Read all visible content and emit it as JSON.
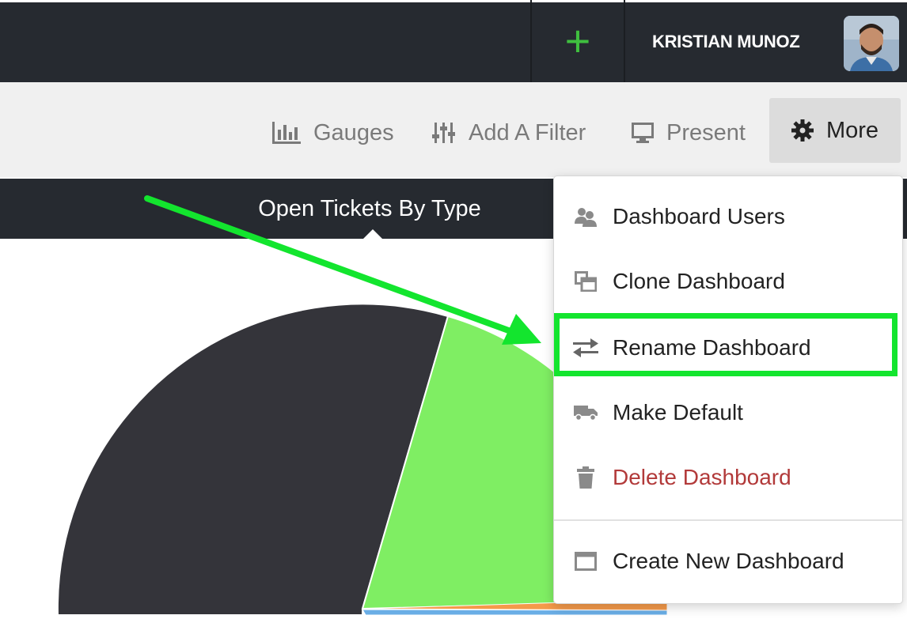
{
  "header": {
    "add_symbol": "+",
    "user_name": "KRISTIAN MUNOZ"
  },
  "toolbar": {
    "gauges_label": "Gauges",
    "add_filter_label": "Add A Filter",
    "present_label": "Present",
    "more_label": "More"
  },
  "chart": {
    "title": "Open Tickets By Type"
  },
  "chart_data": {
    "type": "pie",
    "title": "Open Tickets By Type",
    "slice_colors": [
      "#34343a",
      "#7fee63",
      "#f59a4a",
      "#6aaee6"
    ]
  },
  "more_menu": {
    "items": [
      {
        "label": "Dashboard Users",
        "icon": "users-icon"
      },
      {
        "label": "Clone Dashboard",
        "icon": "clone-icon"
      },
      {
        "label": "Rename Dashboard",
        "icon": "swap-arrows-icon"
      },
      {
        "label": "Make Default",
        "icon": "truck-icon"
      },
      {
        "label": "Delete Dashboard",
        "icon": "trash-icon"
      },
      {
        "label": "Create New Dashboard",
        "icon": "window-icon"
      }
    ]
  },
  "colors": {
    "topbar": "#262a30",
    "accent_green": "#3fbf3f",
    "annotation_green": "#13e52e",
    "danger": "#b23a3a"
  }
}
